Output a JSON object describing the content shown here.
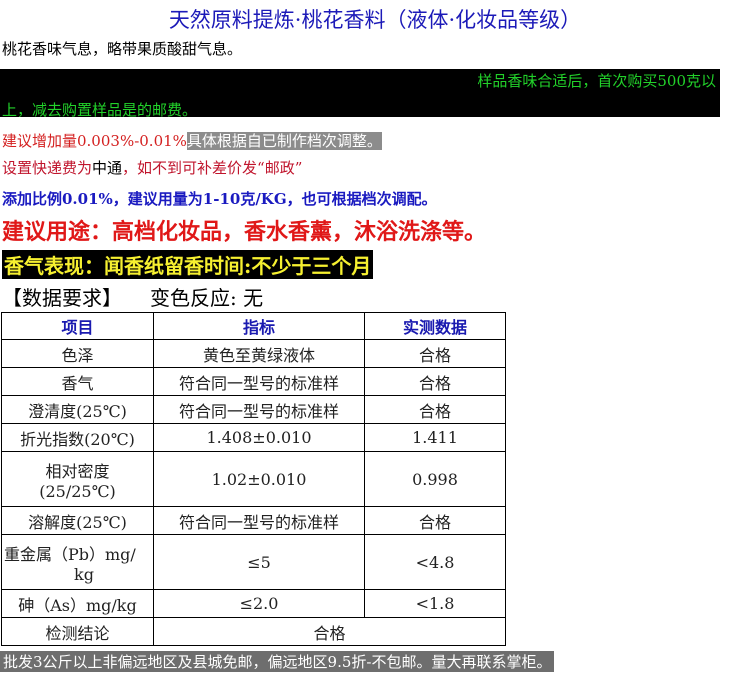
{
  "title": "天然原料提炼·桃花香料（液体·化妆品等级）",
  "intro": "桃花香味气息，略带果质酸甜气息。",
  "sample_notice": {
    "line1": "样品香味合适后，首次购买500克以",
    "line2": "上，减去购置样品是的邮费。"
  },
  "dosage": {
    "red_part": "建议增加量0.003%-0.01%",
    "grey_part": "具体根据自已制作档次调整。"
  },
  "shipping": {
    "part1": "设置快递费为",
    "part2": "中通",
    "part3": "，如不到可补差价发“邮政”"
  },
  "ratio": "添加比例0.01%，建议用量为1-10克/KG，也可根据档次调配。",
  "usage": "建议用途：高档化妆品，香水香薰，沐浴洗涤等。",
  "aroma": "香气表现：闻香纸留香时间:不少于三个月",
  "spec_heading": {
    "left": "【数据要求】",
    "right": "变色反应: 无"
  },
  "table": {
    "headers": [
      "项目",
      "指标",
      "实测数据"
    ],
    "rows": [
      {
        "item": "色泽",
        "spec": "黄色至黄绿液体",
        "result": "合格"
      },
      {
        "item": "香气",
        "spec": "符合同一型号的标准样",
        "result": "合格"
      },
      {
        "item": "澄清度(25℃)",
        "spec": "符合同一型号的标准样",
        "result": "合格"
      },
      {
        "item": "折光指数(20℃)",
        "spec": "1.408±0.010",
        "result": "1.411"
      },
      {
        "item_line1": "相对密度",
        "item_line2": "(25/25℃)",
        "spec": "1.02±0.010",
        "result": "0.998"
      },
      {
        "item": "溶解度(25℃)",
        "spec": "符合同一型号的标准样",
        "result": "合格"
      },
      {
        "item_line1": "重金属（Pb）mg/",
        "item_line2": "kg",
        "spec": "≤5",
        "result": "<4.8"
      },
      {
        "item": "砷（As）mg/kg",
        "spec": "≤2.0",
        "result": "<1.8"
      }
    ],
    "conclusion_label": "检测结论",
    "conclusion_value": "合格"
  },
  "footer": "批发3公斤以上非偏远地区及县城免邮，偏远地区9.5折-不包邮。量大再联系掌柜。"
}
